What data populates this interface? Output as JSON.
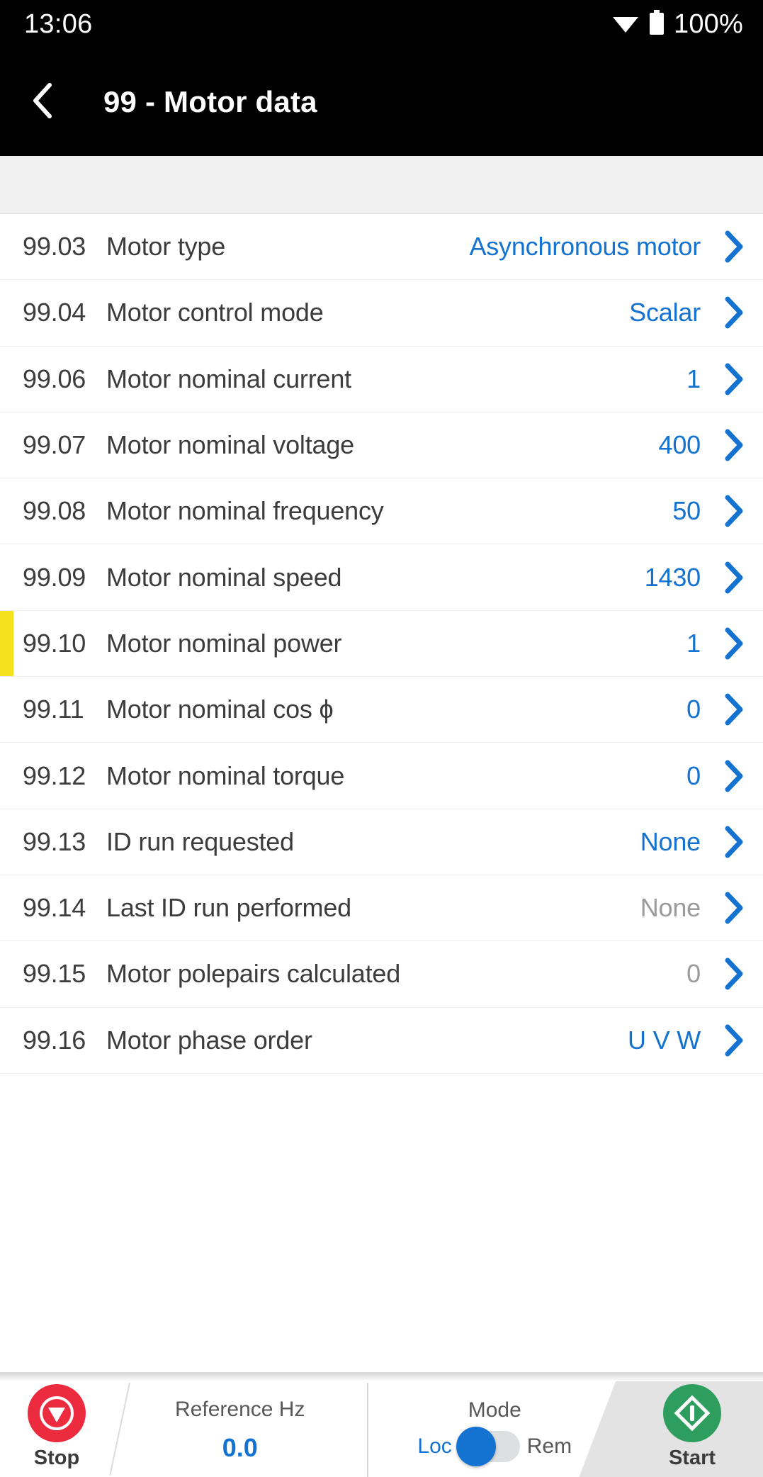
{
  "status_bar": {
    "time": "13:06",
    "battery_percent": "100%",
    "wifi_icon": "wifi-icon",
    "battery_icon": "battery-icon"
  },
  "app_bar": {
    "back_icon": "chevron-left-icon",
    "title": "99 - Motor data"
  },
  "colors": {
    "accent_blue": "#1472d0",
    "readonly_gray": "#9b9b9b",
    "flag_yellow": "#f6e11e",
    "stop_red": "#ec2c3e",
    "start_green": "#2d9e5e",
    "header_black": "#000000",
    "band_gray": "#f0f0f0"
  },
  "parameter_list": [
    {
      "index": "99.03",
      "name": "Motor type",
      "value": "Asynchronous motor",
      "readonly": false,
      "flagged": false
    },
    {
      "index": "99.04",
      "name": "Motor control mode",
      "value": "Scalar",
      "readonly": false,
      "flagged": false
    },
    {
      "index": "99.06",
      "name": "Motor nominal current",
      "value": "1",
      "readonly": false,
      "flagged": false
    },
    {
      "index": "99.07",
      "name": "Motor nominal voltage",
      "value": "400",
      "readonly": false,
      "flagged": false
    },
    {
      "index": "99.08",
      "name": "Motor nominal frequency",
      "value": "50",
      "readonly": false,
      "flagged": false
    },
    {
      "index": "99.09",
      "name": "Motor nominal speed",
      "value": "1430",
      "readonly": false,
      "flagged": false
    },
    {
      "index": "99.10",
      "name": "Motor nominal power",
      "value": "1",
      "readonly": false,
      "flagged": true
    },
    {
      "index": "99.11",
      "name": "Motor nominal cos ϕ",
      "value": "0",
      "readonly": false,
      "flagged": false
    },
    {
      "index": "99.12",
      "name": "Motor nominal torque",
      "value": "0",
      "readonly": false,
      "flagged": false
    },
    {
      "index": "99.13",
      "name": "ID run requested",
      "value": "None",
      "readonly": false,
      "flagged": false
    },
    {
      "index": "99.14",
      "name": "Last ID run performed",
      "value": "None",
      "readonly": true,
      "flagged": false
    },
    {
      "index": "99.15",
      "name": "Motor polepairs calculated",
      "value": "0",
      "readonly": true,
      "flagged": false
    },
    {
      "index": "99.16",
      "name": "Motor phase order",
      "value": "U V W",
      "readonly": false,
      "flagged": false
    }
  ],
  "bottom_bar": {
    "stop": {
      "label": "Stop",
      "icon": "stop-icon"
    },
    "reference": {
      "label": "Reference Hz",
      "value": "0.0"
    },
    "mode": {
      "label": "Mode",
      "local_label": "Loc",
      "remote_label": "Rem",
      "selected": "Loc"
    },
    "start": {
      "label": "Start",
      "icon": "start-icon"
    }
  }
}
